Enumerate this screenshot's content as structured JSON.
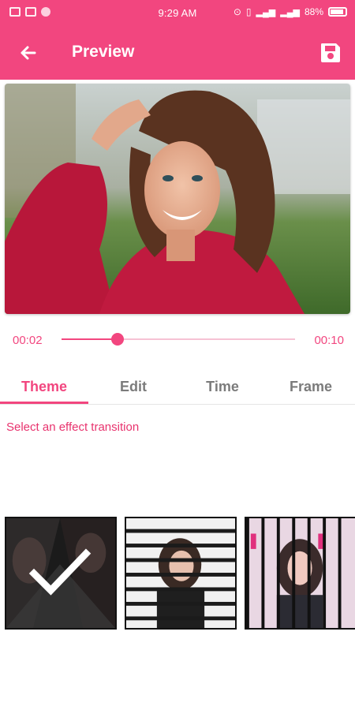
{
  "status_bar": {
    "time": "9:29 AM",
    "battery": "88%"
  },
  "toolbar": {
    "title": "Preview"
  },
  "player": {
    "current_time": "00:02",
    "total_time": "00:10",
    "progress": 0.24,
    "buffered": 0.48
  },
  "tabs": [
    {
      "label": "Theme",
      "active": true
    },
    {
      "label": "Edit",
      "active": false
    },
    {
      "label": "Time",
      "active": false
    },
    {
      "label": "Frame",
      "active": false
    }
  ],
  "effects": {
    "hint": "Select an effect transition",
    "selected_index": 0
  },
  "colors": {
    "accent": "#f2467f",
    "tab_inactive": "#7b7b7b"
  }
}
